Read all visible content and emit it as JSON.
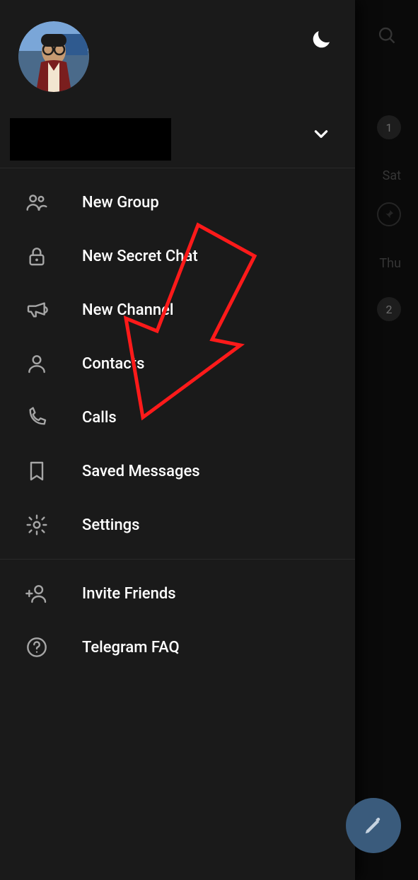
{
  "drawer": {
    "menu": {
      "new_group": "New Group",
      "new_secret_chat": "New Secret Chat",
      "new_channel": "New Channel",
      "contacts": "Contacts",
      "calls": "Calls",
      "saved_messages": "Saved Messages",
      "settings": "Settings",
      "invite_friends": "Invite Friends",
      "telegram_faq": "Telegram FAQ"
    }
  },
  "bg": {
    "badge1": "1",
    "day1": "Sat",
    "day2": "Thu",
    "badge2": "2"
  }
}
